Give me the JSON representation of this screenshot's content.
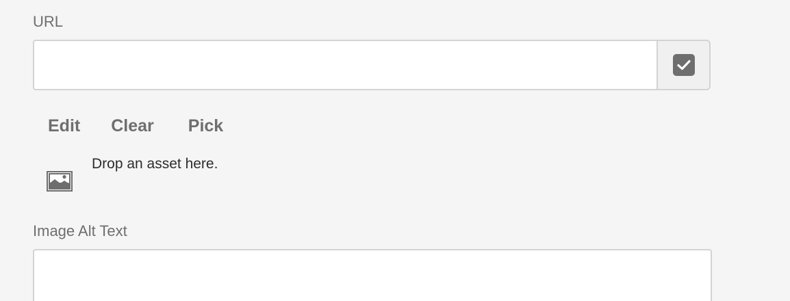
{
  "url_field": {
    "label": "URL",
    "value": "",
    "placeholder": ""
  },
  "url_check_button": {
    "icon": "checkmark-icon",
    "checked": true
  },
  "actions": {
    "edit_label": "Edit",
    "clear_label": "Clear",
    "pick_label": "Pick"
  },
  "drop_zone": {
    "icon": "image-icon",
    "text": "Drop an asset here."
  },
  "alt_text_field": {
    "label": "Image Alt Text",
    "value": "",
    "placeholder": ""
  },
  "colors": {
    "background": "#f5f5f5",
    "border": "#d3d3d3",
    "icon": "#6e6e6e",
    "text": "#2c2c2c"
  }
}
